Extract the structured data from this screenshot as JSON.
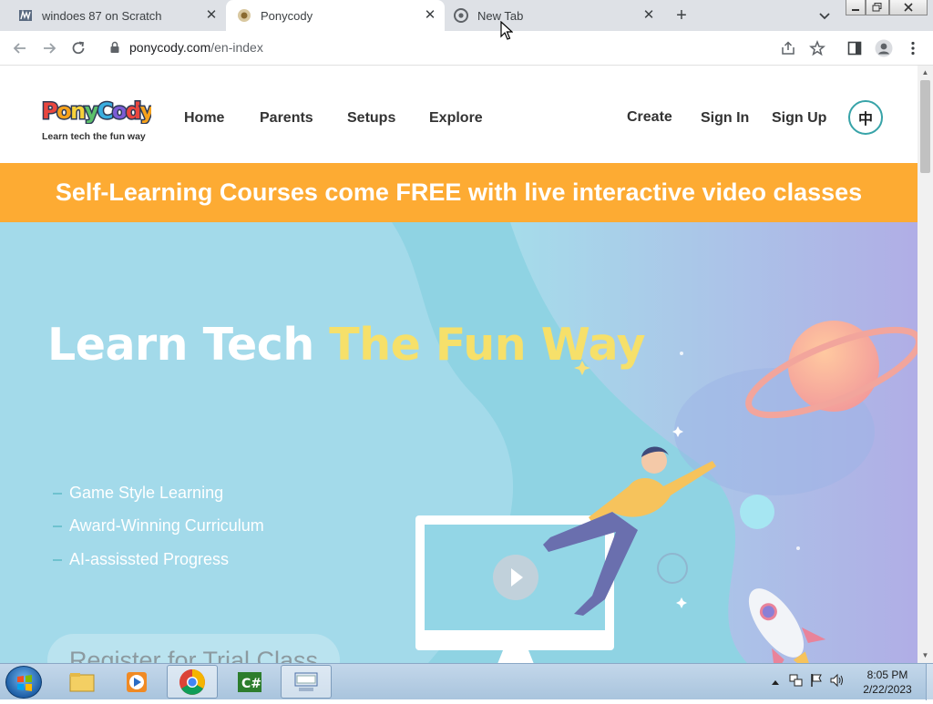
{
  "browser": {
    "tabs": [
      {
        "title": "windoes 87 on Scratch",
        "icon": "scratch-icon"
      },
      {
        "title": "Ponycody",
        "icon": "ponycody-favicon"
      },
      {
        "title": "New Tab",
        "icon": "chrome-icon"
      }
    ],
    "active_tab": 1,
    "url_host": "ponycody.com",
    "url_path": "/en-index"
  },
  "site": {
    "logo_word": "PonyCody",
    "logo_tagline": "Learn tech the fun way",
    "nav": {
      "home": "Home",
      "parents": "Parents",
      "setups": "Setups",
      "explore": "Explore",
      "create": "Create",
      "sign_in": "Sign In",
      "sign_up": "Sign Up",
      "lang": "中"
    },
    "banner": "Self-Learning Courses come FREE with live interactive video classes",
    "hero": {
      "title_main": "Learn Tech ",
      "title_accent": "The Fun Way",
      "features": [
        "Game Style Learning",
        "Award-Winning Curriculum",
        "AI-assissted Progress"
      ],
      "cta": "Register for Trial Class"
    },
    "colors": {
      "banner": "#fdab33",
      "hero_bg": "#8fd3e3",
      "accent_text": "#f6e06a",
      "lang_ring": "#37a3a8"
    }
  },
  "taskbar": {
    "time": "8:05 PM",
    "date": "2/22/2023",
    "items": [
      "explorer-icon",
      "media-player-icon",
      "chrome-icon",
      "csharp-icon",
      "keyboard-icon"
    ],
    "tray_icons": [
      "show-hidden-icon",
      "network-icon",
      "flag-icon",
      "volume-icon"
    ]
  }
}
